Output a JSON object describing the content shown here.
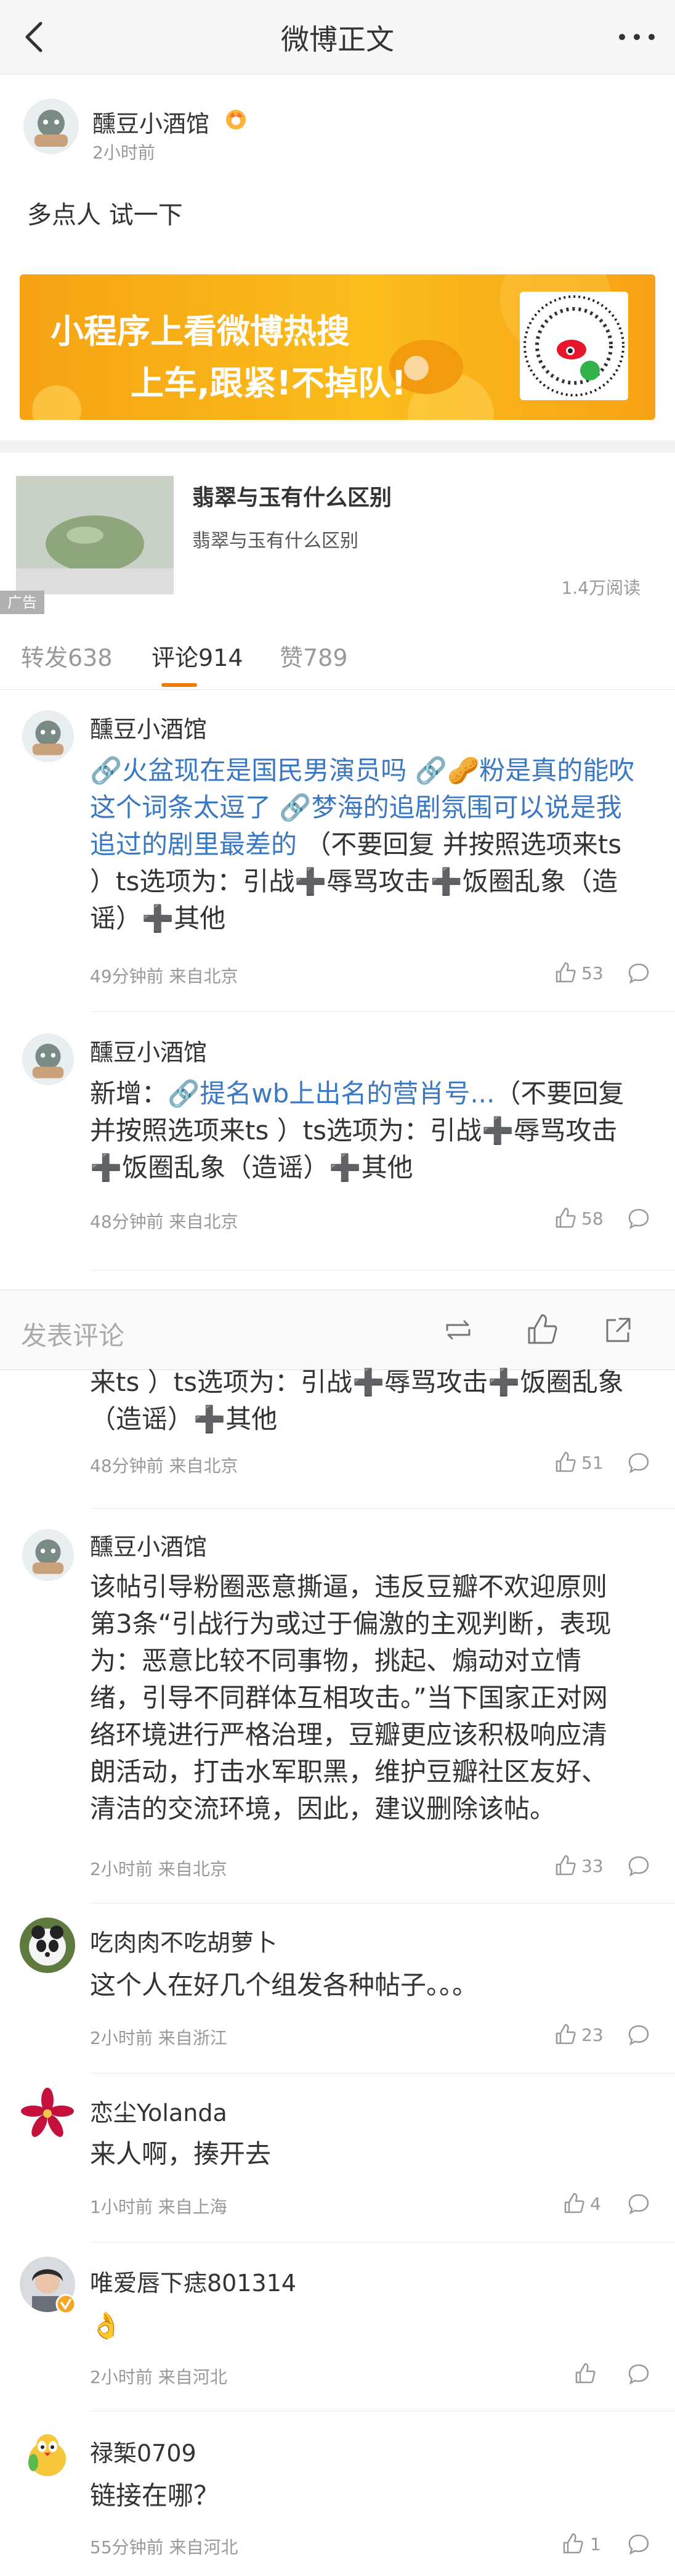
{
  "header": {
    "title": "微博正文"
  },
  "post": {
    "author": "醺豆小酒馆",
    "time": "2小时前",
    "text": "多点人 试一下"
  },
  "banner": {
    "line1": "小程序上看微博热搜",
    "line2": "上车,跟紧!不掉队!"
  },
  "ad": {
    "title": "翡翠与玉有什么区别",
    "subtitle": "翡翠与玉有什么区别",
    "reads": "1.4万阅读",
    "badge": "广告"
  },
  "tabs": [
    {
      "label": "转发638"
    },
    {
      "label": "评论914"
    },
    {
      "label": "赞789"
    }
  ],
  "comments": [
    {
      "name": "醺豆小酒馆",
      "lines": [
        {
          "link1": "火盆现在是国民男演员吗",
          "link2": "粉是真的能吹"
        },
        {
          "l": "这个词条太逗了",
          "link": "梦海的追剧氛围可以说是我"
        },
        {
          "link": "追过的剧里最差的",
          "tail": "（不要回复 并按照选项来ts"
        },
        {
          "t": "）ts选项为：引战➕辱骂攻击➕饭圈乱象（造"
        },
        {
          "t": "谣）➕其他"
        }
      ],
      "meta": "49分钟前 来自北京",
      "likes": "53"
    },
    {
      "name": "醺豆小酒馆",
      "line1_pre": "新增：",
      "line1_link": "提名wb上出名的营肖号...",
      "line1_post": "（不要回复",
      "line2": "并按照选项来ts ）ts选项为：引战➕辱骂攻击",
      "line3": "➕饭圈乱象（造谣）➕其他",
      "meta": "48分钟前 来自北京",
      "likes": "58"
    },
    {
      "partial_line1": "来ts ）ts选项为：引战➕辱骂攻击➕饭圈乱象",
      "partial_line2": "（造谣）➕其他",
      "meta": "48分钟前 来自北京",
      "likes": "51"
    },
    {
      "name": "醺豆小酒馆",
      "lines": [
        "该帖引导粉圈恶意撕逼，违反豆瓣不欢迎原则",
        "第3条“引战行为或过于偏激的主观判断，表现",
        "为：恶意比较不同事物，挑起、煽动对立情",
        "绪，引导不同群体互相攻击。”当下国家正对网",
        "络环境进行严格治理，豆瓣更应该积极响应清",
        "朗活动，打击水军职黑，维护豆瓣社区友好、",
        "清洁的交流环境，因此，建议删除该帖。"
      ],
      "meta": "2小时前 来自北京",
      "likes": "33"
    },
    {
      "name": "吃肉肉不吃胡萝卜",
      "text": "这个人在好几个组发各种帖子。。。",
      "meta": "2小时前 来自浙江",
      "likes": "23"
    },
    {
      "name": "恋尘Yolanda",
      "text": "来人啊，揍开去",
      "meta": "1小时前 来自上海",
      "likes": "4"
    },
    {
      "name": "唯爱唇下痣801314",
      "text": "👌",
      "meta": "2小时前 来自河北",
      "likes": ""
    },
    {
      "name": "禄椠0709",
      "text": "链接在哪？",
      "meta": "55分钟前 来自河北",
      "likes": "1"
    }
  ],
  "action_bar": {
    "placeholder": "发表评论"
  },
  "colors": {
    "link": "#3a78c3",
    "accent": "#f07b00",
    "banner": "#f7a216"
  }
}
